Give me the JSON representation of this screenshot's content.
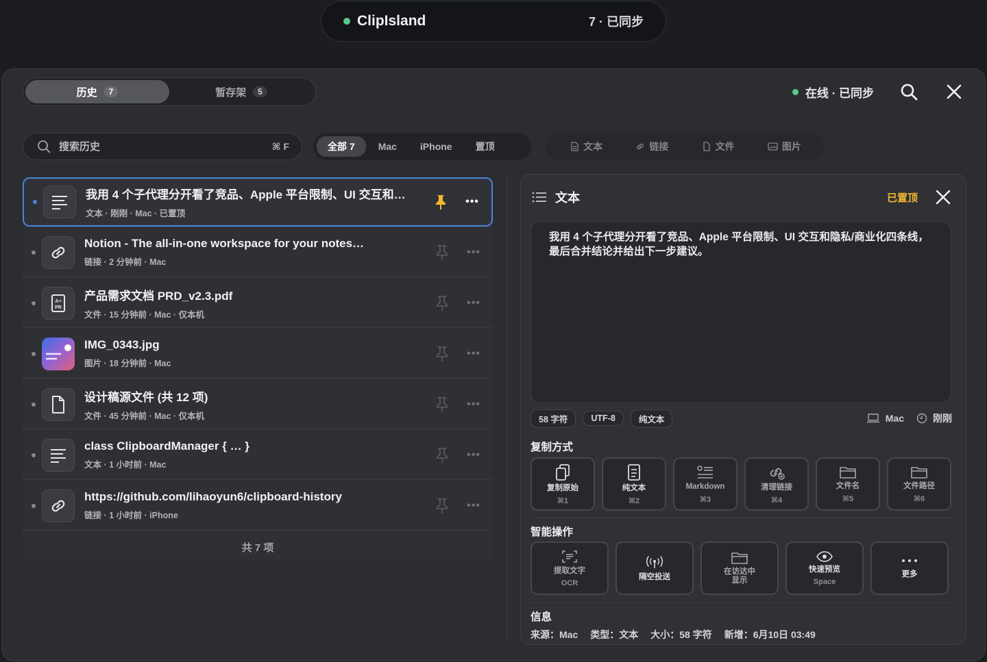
{
  "island": {
    "app_name": "ClipIsland",
    "status": "7 · 已同步"
  },
  "tabs": [
    {
      "label": "历史",
      "count": "7"
    },
    {
      "label": "暂存架",
      "count": "5"
    }
  ],
  "header": {
    "online_status": "在线 · 已同步"
  },
  "search": {
    "placeholder": "搜索历史",
    "shortcut": "⌘ F"
  },
  "filters": [
    {
      "label": "全部 7"
    },
    {
      "label": "Mac"
    },
    {
      "label": "iPhone"
    },
    {
      "label": "置顶"
    }
  ],
  "type_filters": [
    {
      "label": "文本",
      "icon": "text-doc-icon"
    },
    {
      "label": "链接",
      "icon": "link-icon"
    },
    {
      "label": "文件",
      "icon": "file-icon"
    },
    {
      "label": "图片",
      "icon": "image-icon"
    }
  ],
  "items": [
    {
      "title": "我用 4 个子代理分开看了竞品、Apple 平台限制、UI 交互和…",
      "meta": "文本 · 刚刚 · Mac · 已置顶",
      "icon": "text-lines-icon"
    },
    {
      "title": "Notion - The all-in-one workspace for your notes…",
      "meta": "链接 · 2 分钟前 · Mac",
      "icon": "link-icon"
    },
    {
      "title": "产品需求文档 PRD_v2.3.pdf",
      "meta": "文件 · 15 分钟前 · Mac · 仅本机",
      "icon": "pdf-icon"
    },
    {
      "title": "IMG_0343.jpg",
      "meta": "图片 · 18 分钟前 · Mac",
      "icon": "image-thumbnail"
    },
    {
      "title": "设计稿源文件 (共 12 项)",
      "meta": "文件 · 45 分钟前 · Mac · 仅本机",
      "icon": "file-icon"
    },
    {
      "title": "class ClipboardManager { … }",
      "meta": "文本 · 1 小时前 · Mac",
      "icon": "text-lines-icon"
    },
    {
      "title": "https://github.com/lihaoyun6/clipboard-history",
      "meta": "链接 · 1 小时前 · iPhone",
      "icon": "link-icon"
    }
  ],
  "list_footer": "共 7 项",
  "detail": {
    "type_label": "文本",
    "pinned_label": "已置顶",
    "content": "我用 4 个子代理分开看了竞品、Apple 平台限制、UI 交互和隐私/商业化四条线，最后合并结论并给出下一步建议。",
    "tags": [
      "58 字符",
      "UTF-8",
      "纯文本"
    ],
    "device": "Mac",
    "time": "刚刚",
    "copy_section_title": "复制方式",
    "copy_actions": [
      {
        "label": "复制原始",
        "key": "⌘1",
        "icon": "copy-icon"
      },
      {
        "label": "纯文本",
        "key": "⌘2",
        "icon": "plain-text-icon"
      },
      {
        "label": "Markdown",
        "key": "⌘3",
        "icon": "markdown-icon"
      },
      {
        "label": "清理链接",
        "key": "⌘4",
        "icon": "clean-link-icon"
      },
      {
        "label": "文件名",
        "key": "⌘5",
        "icon": "folder-icon"
      },
      {
        "label": "文件路径",
        "key": "⌘6",
        "icon": "folder-path-icon"
      }
    ],
    "smart_section_title": "智能操作",
    "smart_actions": [
      {
        "label": "提取文字",
        "key": "OCR",
        "icon": "ocr-icon"
      },
      {
        "label": "隔空投送",
        "key": "",
        "icon": "airdrop-icon"
      },
      {
        "label": "在访达中\n显示",
        "key": "",
        "icon": "finder-icon"
      },
      {
        "label": "快速预览",
        "key": "Space",
        "icon": "eye-icon"
      },
      {
        "label": "更多",
        "key": "",
        "icon": "more-icon"
      }
    ],
    "info_section_title": "信息",
    "info": [
      "来源：Mac",
      "类型：文本",
      "大小：58 字符",
      "新增：6月10日 03:49"
    ]
  },
  "colors": {
    "accent": "#4a86d8",
    "online": "#59c98a",
    "pinned": "#f5b82e"
  }
}
